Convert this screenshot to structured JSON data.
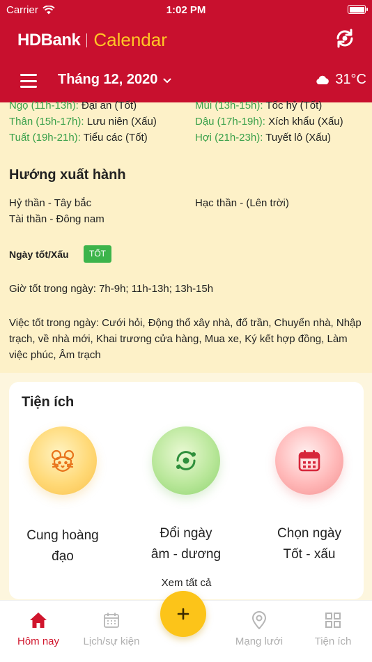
{
  "status_bar": {
    "carrier": "Carrier",
    "time": "1:02 PM"
  },
  "header": {
    "brand": "HDBank",
    "app_name": "Calendar",
    "month_label": "Tháng 12, 2020",
    "temperature": "31°C",
    "weather_icon": "cloud-icon",
    "colors": {
      "primary": "#c8102e",
      "accent": "#ffc726"
    }
  },
  "hours": [
    {
      "time": "Ngọ (11h-13h):",
      "desc": "Đại an (Tốt)"
    },
    {
      "time": "Mùi (13h-15h):",
      "desc": "Tốc hỷ (Tốt)"
    },
    {
      "time": "Thân (15h-17h):",
      "desc": "Lưu niên (Xấu)"
    },
    {
      "time": "Dậu (17h-19h):",
      "desc": "Xích khẩu (Xấu)"
    },
    {
      "time": "Tuất (19h-21h):",
      "desc": "Tiểu các (Tốt)"
    },
    {
      "time": "Hợi (21h-23h):",
      "desc": "Tuyết lô (Xấu)"
    }
  ],
  "direction": {
    "title": "Hướng xuất hành",
    "hy_than": "Hỷ thần - Tây bắc",
    "hac_than": "Hạc thần - (Lên trời)",
    "tai_than": "Tài thần - Đông nam"
  },
  "day_quality": {
    "label": "Ngày tốt/Xấu",
    "badge": "TỐT",
    "badge_color": "#3cb44b"
  },
  "good_hours": "Giờ tốt trong ngày: 7h-9h; 11h-13h; 13h-15h",
  "good_tasks": "Việc tốt trong ngày: Cưới hỏi, Động thổ xây nhà, đổ trần, Chuyển nhà, Nhập trạch, về nhà mới, Khai trương cửa hàng, Mua xe, Ký kết hợp đồng, Làm việc phúc, Âm trạch",
  "utilities": {
    "title": "Tiện ích",
    "items": [
      {
        "line1": "Cung hoàng",
        "line2": "đạo",
        "icon": "rat-icon"
      },
      {
        "line1": "Đổi ngày",
        "line2": "âm - dương",
        "icon": "convert-icon"
      },
      {
        "line1": "Chọn ngày",
        "line2": "Tốt - xấu",
        "icon": "calendar-icon"
      }
    ],
    "see_all": "Xem tất cả"
  },
  "tabbar": {
    "items": [
      {
        "label": "Hôm nay",
        "icon": "home-icon",
        "active": true
      },
      {
        "label": "Lịch/sự kiện",
        "icon": "calendar-icon"
      },
      {
        "label": "Mạng lưới",
        "icon": "location-pin-icon"
      },
      {
        "label": "Tiện ích",
        "icon": "grid-icon"
      }
    ],
    "fab_icon": "plus-icon"
  }
}
